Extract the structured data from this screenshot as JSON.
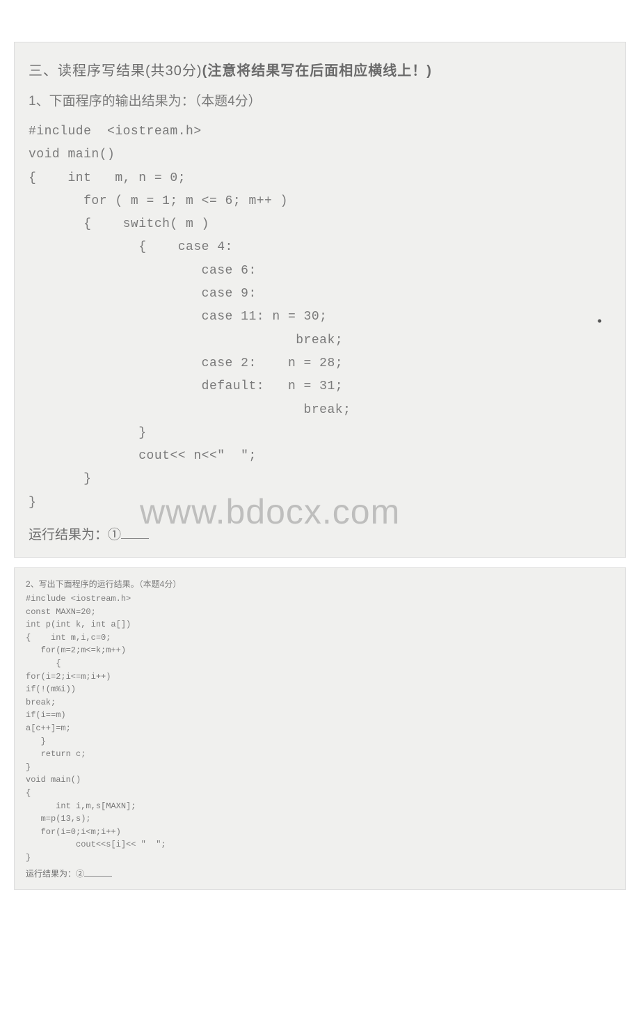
{
  "section1": {
    "heading_prefix": "三、读程序写结果(共30分)",
    "heading_bold": "(注意将结果写在后面相应横线上！)",
    "question": "1、下面程序的输出结果为：（本题4分）",
    "code": "#include  <iostream.h>\nvoid main()\n{    int   m, n = 0;\n       for ( m = 1; m <= 6; m++ )\n       {    switch( m )\n              {    case 4:\n                      case 6:\n                      case 9:\n                      case 11: n = 30;\n                                  break;\n                      case 2:    n = 28;\n                      default:   n = 31;\n                                   break;\n              }\n              cout<< n<<\"  \";\n       }\n}",
    "result_label": "运行结果为：①",
    "watermark": "www.bdocx.com"
  },
  "section2": {
    "question": "2、写出下面程序的运行结果。（本题4分）",
    "code": "#include <iostream.h>\nconst MAXN=20;\nint p(int k, int a[])\n{    int m,i,c=0;\n   for(m=2;m<=k;m++)\n      {\nfor(i=2;i<=m;i++)\nif(!(m%i))\nbreak;\nif(i==m)\na[c++]=m;\n   }\n   return c;\n}\nvoid main()\n{\n      int i,m,s[MAXN];\n   m=p(13,s);\n   for(i=0;i<m;i++)\n          cout<<s[i]<< \"  \";\n}",
    "result_label": "运行结果为：②"
  }
}
